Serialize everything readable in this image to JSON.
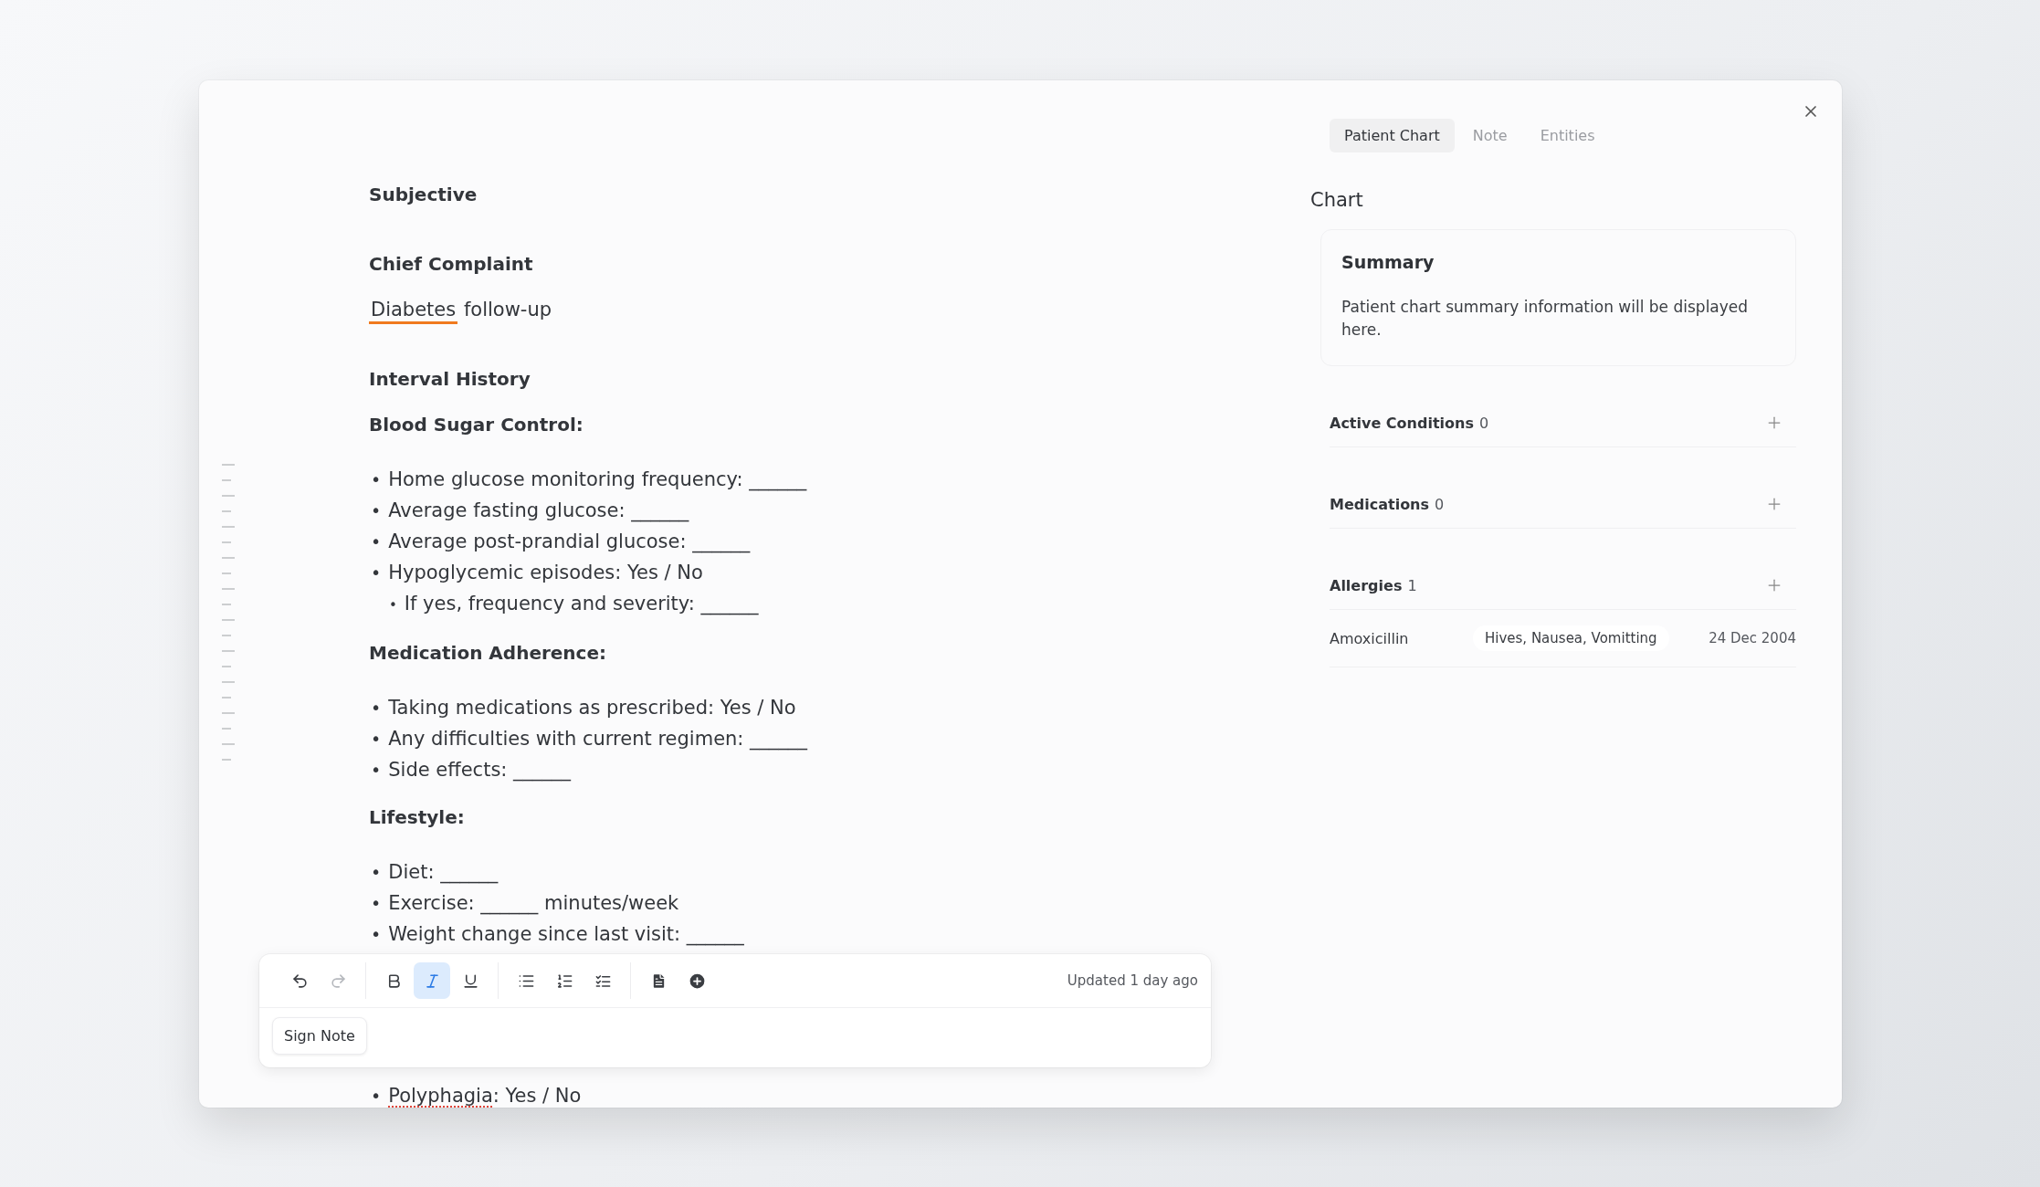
{
  "note": {
    "blocks": [
      {
        "kind": "heading",
        "text": "Subjective"
      },
      {
        "kind": "heading",
        "text": "Chief Complaint"
      },
      {
        "kind": "paragraph",
        "segments": [
          {
            "text": "Diabetes",
            "entity": true
          },
          {
            "text": " follow-up",
            "entity": false
          }
        ]
      },
      {
        "kind": "heading",
        "text": "Interval History"
      },
      {
        "kind": "label",
        "text": "Blood Sugar Control:"
      },
      {
        "kind": "list",
        "items": [
          {
            "bullet": "•",
            "segments": [
              {
                "text": "Home glucose monitoring frequency: ______"
              }
            ]
          },
          {
            "bullet": "•",
            "segments": [
              {
                "text": "Average fasting glucose: ______"
              }
            ]
          },
          {
            "bullet": "•",
            "segments": [
              {
                "text": "Average post-prandial glucose: ______"
              }
            ]
          },
          {
            "bullet": "•",
            "segments": [
              {
                "text": "Hypoglycemic episodes: Yes / No"
              }
            ],
            "children": [
              {
                "bullet": "•",
                "segments": [
                  {
                    "text": "If yes, frequency and severity: ______"
                  }
                ]
              }
            ]
          }
        ]
      },
      {
        "kind": "label",
        "text": "Medication Adherence:"
      },
      {
        "kind": "list",
        "items": [
          {
            "bullet": "•",
            "segments": [
              {
                "text": "Taking medications as prescribed: Yes / No"
              }
            ]
          },
          {
            "bullet": "•",
            "segments": [
              {
                "text": "Any difficulties with current regimen: ______"
              }
            ]
          },
          {
            "bullet": "•",
            "segments": [
              {
                "text": "Side effects: ______"
              }
            ]
          }
        ]
      },
      {
        "kind": "label",
        "text": "Lifestyle:"
      },
      {
        "kind": "list",
        "items": [
          {
            "bullet": "•",
            "segments": [
              {
                "text": "Diet: ______"
              }
            ]
          },
          {
            "bullet": "•",
            "segments": [
              {
                "text": "Exercise: ______ minutes/week"
              }
            ]
          },
          {
            "bullet": "•",
            "segments": [
              {
                "text": "Weight change since last visit: ______"
              }
            ]
          }
        ]
      },
      {
        "kind": "list",
        "covered": true,
        "items": [
          {
            "bullet": "•",
            "segments": [
              {
                "text": "Polyphagia",
                "misspelled": true
              },
              {
                "text": ": Yes / No",
                "misspelled": false
              }
            ]
          }
        ]
      }
    ]
  },
  "toolbar": {
    "groups": [
      [
        {
          "kind": "undo",
          "selected": false,
          "disabled": false
        },
        {
          "kind": "redo",
          "selected": false,
          "disabled": true
        }
      ],
      [
        {
          "kind": "bold",
          "selected": false,
          "disabled": false
        },
        {
          "kind": "italic",
          "selected": true,
          "disabled": false
        },
        {
          "kind": "underline",
          "selected": false,
          "disabled": false
        }
      ],
      [
        {
          "kind": "bullet_list",
          "selected": false,
          "disabled": false
        },
        {
          "kind": "numbered_list",
          "selected": false,
          "disabled": false
        },
        {
          "kind": "task_list",
          "selected": false,
          "disabled": false
        }
      ],
      [
        {
          "kind": "document",
          "selected": false,
          "disabled": false
        },
        {
          "kind": "insert",
          "selected": false,
          "disabled": false
        }
      ]
    ],
    "status": "Updated 1 day ago",
    "sign_button": "Sign Note"
  },
  "tabs": [
    {
      "label": "Patient Chart",
      "selected": true
    },
    {
      "label": "Note",
      "selected": false
    },
    {
      "label": "Entities",
      "selected": false
    }
  ],
  "chart": {
    "title": "Chart",
    "summary": {
      "title": "Summary",
      "text": "Patient chart summary information will be displayed here."
    },
    "sections": [
      {
        "title": "Active Conditions",
        "count": "0"
      },
      {
        "title": "Medications",
        "count": "0"
      },
      {
        "title": "Allergies",
        "count": "1",
        "rows": [
          {
            "name": "Amoxicillin",
            "reactions": "Hives, Nausea, Vomitting",
            "date": "24 Dec 2004"
          }
        ]
      }
    ]
  }
}
